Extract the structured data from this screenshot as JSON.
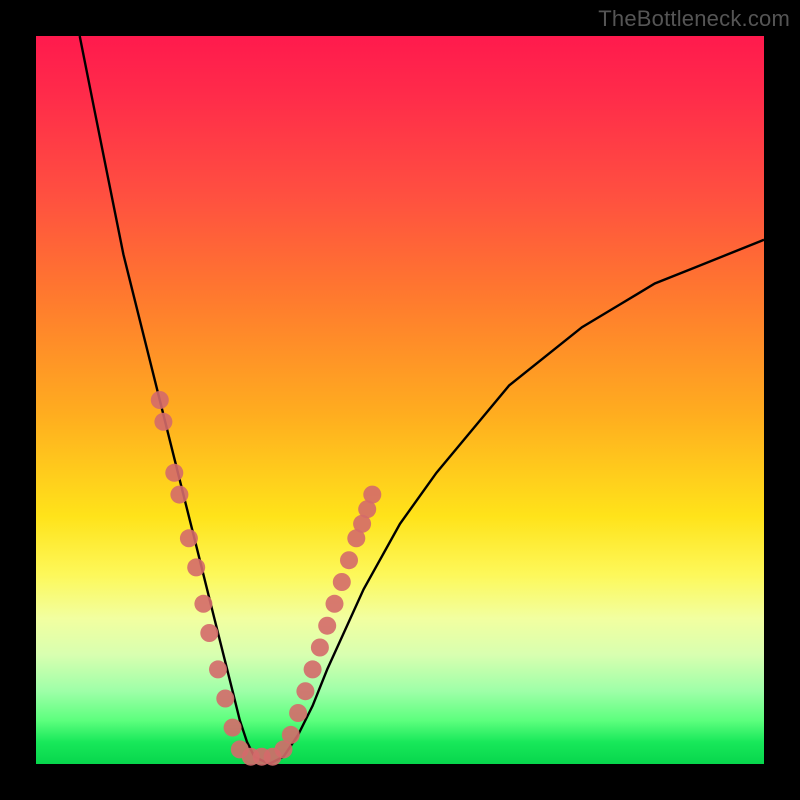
{
  "watermark": "TheBottleneck.com",
  "colors": {
    "frame": "#000000",
    "gradient_top": "#ff1a4d",
    "gradient_mid": "#ffe31a",
    "gradient_bottom": "#07d64c",
    "curve": "#000000",
    "marker": "#d46a6a"
  },
  "chart_data": {
    "type": "line",
    "title": "",
    "xlabel": "",
    "ylabel": "",
    "xlim": [
      0,
      100
    ],
    "ylim": [
      0,
      100
    ],
    "grid": false,
    "legend": false,
    "series": [
      {
        "name": "curve",
        "x": [
          6,
          8,
          10,
          12,
          14,
          16,
          18,
          20,
          22,
          24,
          26,
          27,
          28,
          29,
          30,
          32,
          34,
          36,
          38,
          40,
          45,
          50,
          55,
          60,
          65,
          70,
          75,
          80,
          85,
          90,
          95,
          100
        ],
        "y": [
          100,
          90,
          80,
          70,
          62,
          54,
          46,
          38,
          30,
          22,
          14,
          10,
          6,
          3,
          1,
          0,
          1,
          4,
          8,
          13,
          24,
          33,
          40,
          46,
          52,
          56,
          60,
          63,
          66,
          68,
          70,
          72
        ]
      }
    ],
    "markers": [
      {
        "x": 17,
        "y": 50
      },
      {
        "x": 17.5,
        "y": 47
      },
      {
        "x": 19,
        "y": 40
      },
      {
        "x": 19.7,
        "y": 37
      },
      {
        "x": 21,
        "y": 31
      },
      {
        "x": 22,
        "y": 27
      },
      {
        "x": 23,
        "y": 22
      },
      {
        "x": 23.8,
        "y": 18
      },
      {
        "x": 25,
        "y": 13
      },
      {
        "x": 26,
        "y": 9
      },
      {
        "x": 27,
        "y": 5
      },
      {
        "x": 28,
        "y": 2
      },
      {
        "x": 29.5,
        "y": 1
      },
      {
        "x": 31,
        "y": 1
      },
      {
        "x": 32.5,
        "y": 1
      },
      {
        "x": 34,
        "y": 2
      },
      {
        "x": 35,
        "y": 4
      },
      {
        "x": 36,
        "y": 7
      },
      {
        "x": 37,
        "y": 10
      },
      {
        "x": 38,
        "y": 13
      },
      {
        "x": 39,
        "y": 16
      },
      {
        "x": 40,
        "y": 19
      },
      {
        "x": 41,
        "y": 22
      },
      {
        "x": 42,
        "y": 25
      },
      {
        "x": 43,
        "y": 28
      },
      {
        "x": 44,
        "y": 31
      },
      {
        "x": 44.8,
        "y": 33
      },
      {
        "x": 45.5,
        "y": 35
      },
      {
        "x": 46.2,
        "y": 37
      }
    ],
    "note": "Curve is a V-shaped profile; markers cluster on both limbs near the bottom. No axes, ticks, or labels are rendered in the source image."
  }
}
